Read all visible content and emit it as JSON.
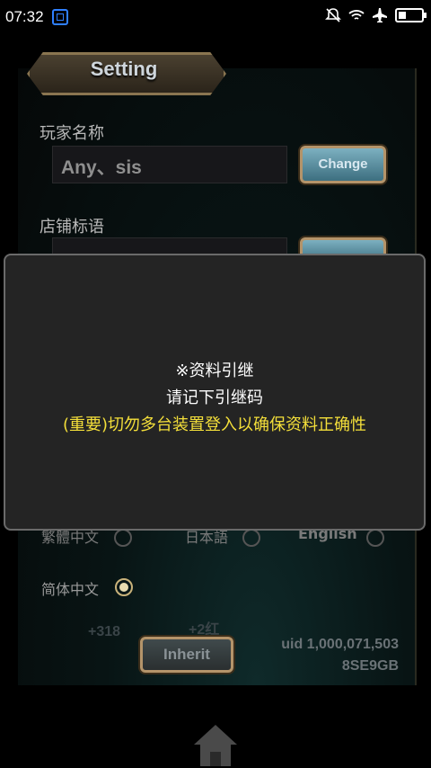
{
  "status_bar": {
    "time": "07:32",
    "icons": [
      "app-screenshot-icon",
      "bell-muted-icon",
      "wifi-icon",
      "airplane-icon",
      "battery-icon"
    ]
  },
  "settings": {
    "title": "Setting",
    "player_name_label": "玩家名称",
    "player_name_value": "Any、sis",
    "change_button": "Change",
    "shop_slogan_label": "店铺标语",
    "languages": [
      {
        "label": "繁體中文",
        "selected": false
      },
      {
        "label": "日本語",
        "selected": false
      },
      {
        "label": "English",
        "selected": false
      },
      {
        "label": "简体中文",
        "selected": true
      }
    ],
    "reward_1": "+318",
    "reward_2": "+2红",
    "inherit_button": "Inherit",
    "uid": "uid 1,000,071,503",
    "code": "8SE9GB"
  },
  "dialog": {
    "line1": "※资料引继",
    "line2": "请记下引继码",
    "line3": "(重要)切勿多台装置登入以确保资料正确性",
    "warn_color": "#f4df3a"
  },
  "footer": {
    "home_icon": "home-icon"
  }
}
